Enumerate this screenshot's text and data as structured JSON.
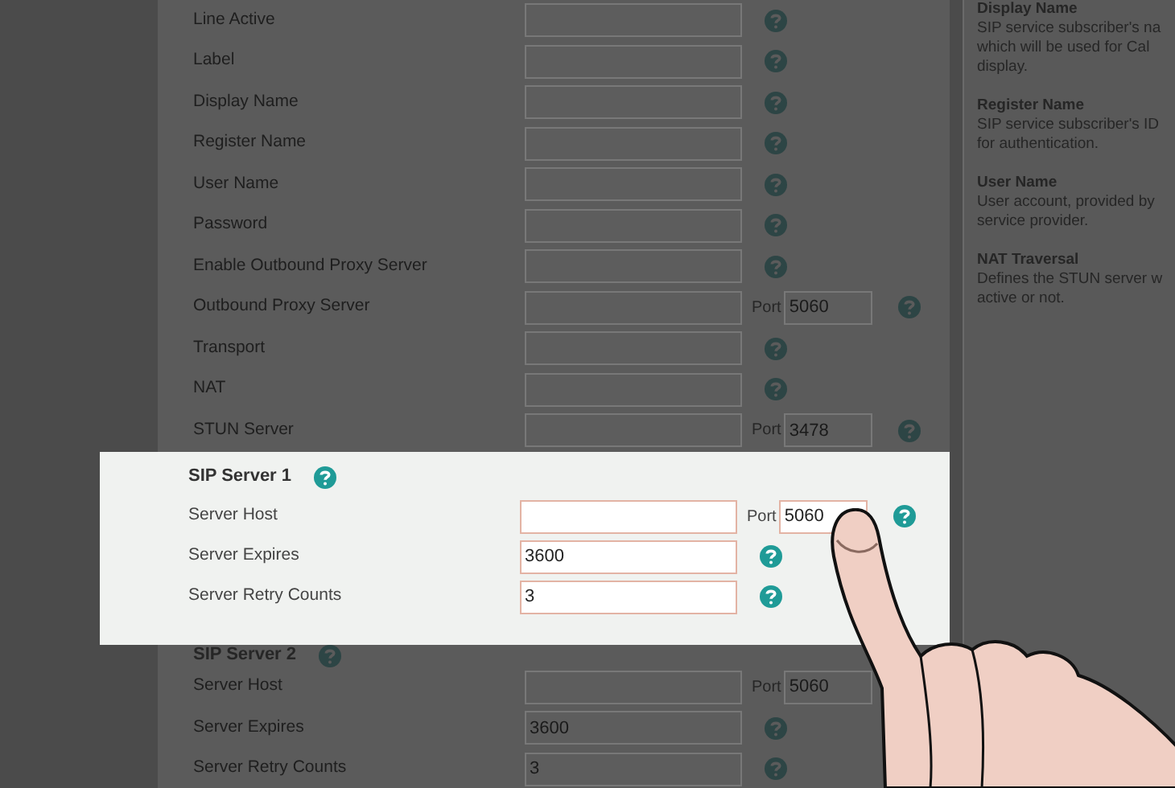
{
  "sections": [
    {
      "highlighted": false,
      "rows": [
        {
          "label": "Line Active"
        },
        {
          "label": "Label"
        },
        {
          "label": "Display Name"
        },
        {
          "label": "Register Name"
        },
        {
          "label": "User Name"
        },
        {
          "label": "Password"
        },
        {
          "label": "Enable Outbound Proxy Server"
        },
        {
          "label": "Outbound Proxy Server",
          "port_label": "Port",
          "port": "5060"
        },
        {
          "label": "Transport"
        },
        {
          "label": "NAT"
        },
        {
          "label": "STUN Server",
          "port_label": "Port",
          "port": "3478"
        }
      ]
    },
    {
      "highlighted": true,
      "heading": "SIP Server 1",
      "rows": [
        {
          "label": "Server Host",
          "value": "",
          "port_label": "Port",
          "port": "5060"
        },
        {
          "label": "Server Expires",
          "value": "3600"
        },
        {
          "label": "Server Retry Counts",
          "value": "3"
        }
      ]
    },
    {
      "highlighted": false,
      "heading": "SIP Server 2",
      "rows": [
        {
          "label": "Server Host",
          "value": "",
          "port_label": "Port",
          "port": "5060"
        },
        {
          "label": "Server Expires",
          "value": "3600"
        },
        {
          "label": "Server Retry Counts",
          "value": "3"
        }
      ]
    }
  ],
  "help": [
    {
      "title": "Display Name",
      "lines": [
        "SIP service subscriber's na",
        "which will be used for Cal",
        "display."
      ]
    },
    {
      "title": "Register Name",
      "lines": [
        "SIP service subscriber's ID",
        "for authentication."
      ]
    },
    {
      "title": "User Name",
      "lines": [
        "User account, provided by",
        "service provider."
      ]
    },
    {
      "title": "NAT Traversal",
      "lines": [
        "Defines the STUN server w",
        "active or not."
      ]
    }
  ]
}
